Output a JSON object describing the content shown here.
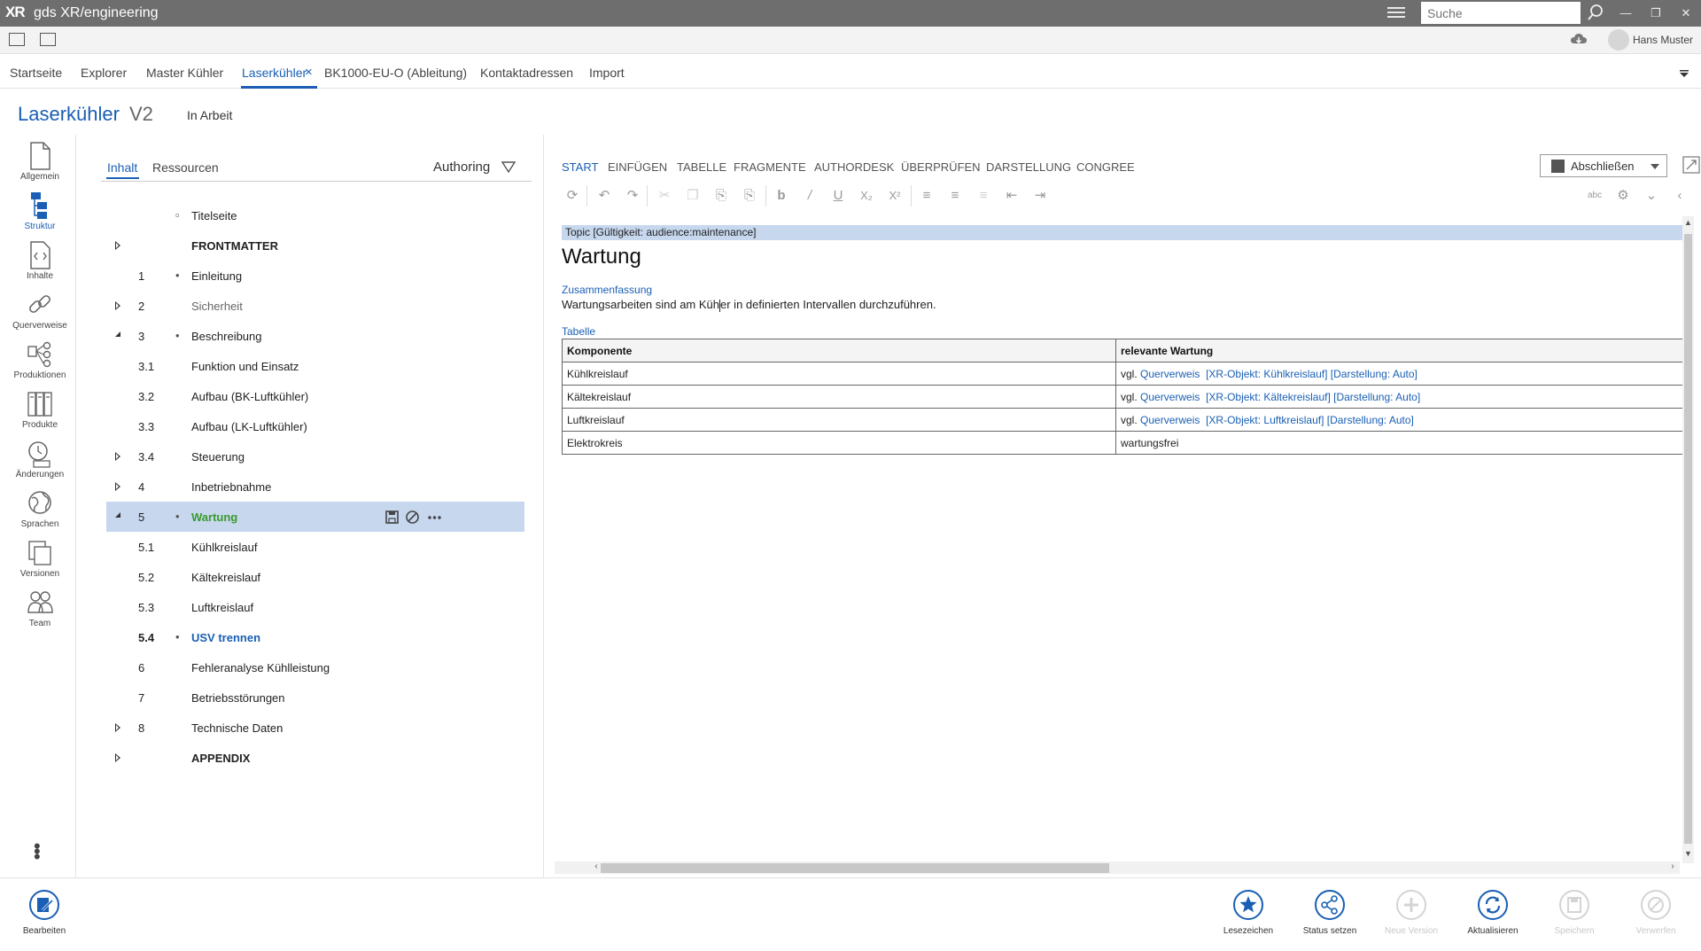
{
  "app": {
    "logo": "XR",
    "title": "gds XR/engineering",
    "user": "Hans Muster"
  },
  "search": {
    "placeholder": "Suche"
  },
  "tabs": [
    "Startseite",
    "Explorer",
    "Master Kühler",
    "Laserkühler",
    "BK1000-EU-O (Ableitung)",
    "Kontaktadressen",
    "Import"
  ],
  "active_tab": "Laserkühler",
  "document": {
    "title": "Laserkühler",
    "version": "V2",
    "status": "In Arbeit"
  },
  "leftnav": [
    {
      "label": "Allgemein",
      "icon": "document-icon"
    },
    {
      "label": "Struktur",
      "icon": "structure-icon"
    },
    {
      "label": "Inhalte",
      "icon": "content-icon"
    },
    {
      "label": "Querverweise",
      "icon": "link-icon"
    },
    {
      "label": "Produktionen",
      "icon": "production-icon"
    },
    {
      "label": "Produkte",
      "icon": "products-icon"
    },
    {
      "label": "Änderungen",
      "icon": "changes-icon"
    },
    {
      "label": "Sprachen",
      "icon": "globe-icon"
    },
    {
      "label": "Versionen",
      "icon": "versions-icon"
    },
    {
      "label": "Team",
      "icon": "team-icon"
    }
  ],
  "panel": {
    "tabs": [
      "Inhalt",
      "Ressourcen"
    ],
    "mode": "Authoring"
  },
  "tree": [
    {
      "num": "",
      "label": "Titelseite",
      "expander": "",
      "bullet": "▫",
      "style": ""
    },
    {
      "num": "",
      "label": "FRONTMATTER",
      "expander": "closed",
      "bullet": "",
      "style": "bold"
    },
    {
      "num": "1",
      "label": "Einleitung",
      "expander": "",
      "bullet": "•",
      "style": ""
    },
    {
      "num": "2",
      "label": "Sicherheit",
      "expander": "closed",
      "bullet": "",
      "style": "gray"
    },
    {
      "num": "3",
      "label": "Beschreibung",
      "expander": "open",
      "bullet": "•",
      "style": ""
    },
    {
      "num": "3.1",
      "label": "Funktion und Einsatz",
      "expander": "",
      "bullet": "",
      "style": ""
    },
    {
      "num": "3.2",
      "label": "Aufbau (BK-Luftkühler)",
      "expander": "",
      "bullet": "",
      "style": ""
    },
    {
      "num": "3.3",
      "label": "Aufbau (LK-Luftkühler)",
      "expander": "",
      "bullet": "",
      "style": ""
    },
    {
      "num": "3.4",
      "label": "Steuerung",
      "expander": "closed",
      "bullet": "",
      "style": ""
    },
    {
      "num": "4",
      "label": "Inbetriebnahme",
      "expander": "closed",
      "bullet": "",
      "style": ""
    },
    {
      "num": "5",
      "label": "Wartung",
      "expander": "open",
      "bullet": "•",
      "style": "green",
      "selected": true
    },
    {
      "num": "5.1",
      "label": "Kühlkreislauf",
      "expander": "",
      "bullet": "",
      "style": ""
    },
    {
      "num": "5.2",
      "label": "Kältekreislauf",
      "expander": "",
      "bullet": "",
      "style": ""
    },
    {
      "num": "5.3",
      "label": "Luftkreislauf",
      "expander": "",
      "bullet": "",
      "style": ""
    },
    {
      "num": "5.4",
      "label": "USV trennen",
      "expander": "",
      "bullet": "•",
      "style": "blue"
    },
    {
      "num": "6",
      "label": "Fehleranalyse Kühlleistung",
      "expander": "",
      "bullet": "",
      "style": ""
    },
    {
      "num": "7",
      "label": "Betriebsstörungen",
      "expander": "",
      "bullet": "",
      "style": ""
    },
    {
      "num": "8",
      "label": "Technische Daten",
      "expander": "closed",
      "bullet": "",
      "style": ""
    },
    {
      "num": "",
      "label": "APPENDIX",
      "expander": "closed",
      "bullet": "",
      "style": "bold"
    }
  ],
  "editor": {
    "ribbon_tabs": [
      "START",
      "EINFÜGEN",
      "TABELLE",
      "FRAGMENTE",
      "AUTHORDESK",
      "ÜBERPRÜFEN",
      "DARSTELLUNG",
      "CONGREE"
    ],
    "finish_button": "Abschließen",
    "topic_bar": "Topic  [Gültigkeit: audience:maintenance]",
    "heading": "Wartung",
    "summary_label": "Zusammenfassung",
    "summary_before": "Wartungsarbeiten sind am Küh",
    "summary_after": "er in definierten Intervallen durchzuführen.",
    "table_label": "Tabelle",
    "table": {
      "headers": [
        "Komponente",
        "relevante Wartung"
      ],
      "rows": [
        {
          "component": "Kühlkreislauf",
          "prefix": "vgl.",
          "link": "Querverweis",
          "ref": "[XR-Objekt: Kühlkreislauf] [Darstellung: Auto]"
        },
        {
          "component": "Kältekreislauf",
          "prefix": "vgl.",
          "link": "Querverweis",
          "ref": "[XR-Objekt: Kältekreislauf] [Darstellung: Auto]"
        },
        {
          "component": "Luftkreislauf",
          "prefix": "vgl.",
          "link": "Querverweis",
          "ref": "[XR-Objekt: Luftkreislauf] [Darstellung: Auto]"
        },
        {
          "component": "Elektrokreis",
          "prefix": "wartungsfrei",
          "link": "",
          "ref": ""
        }
      ]
    }
  },
  "bottom_actions": [
    {
      "label": "Bearbeiten",
      "enabled": true
    },
    {
      "label": "Lesezeichen",
      "enabled": true
    },
    {
      "label": "Status setzen",
      "enabled": true
    },
    {
      "label": "Neue Version",
      "enabled": false
    },
    {
      "label": "Aktualisieren",
      "enabled": true
    },
    {
      "label": "Speichern",
      "enabled": false
    },
    {
      "label": "Verwerfen",
      "enabled": false
    }
  ],
  "colors": {
    "accent": "#1a5fb4",
    "titlebar": "#6e6e6e",
    "selection": "#c6d7ee",
    "active_node": "#3a9a2e"
  }
}
